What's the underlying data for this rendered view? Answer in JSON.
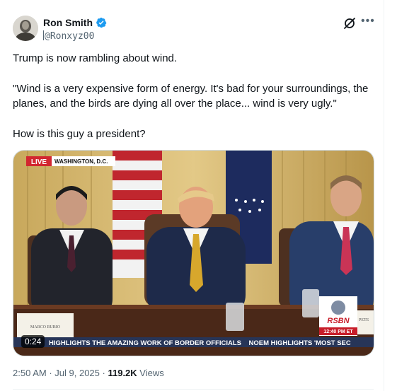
{
  "author": {
    "display_name": "Ron Smith",
    "handle": "@Ronxyz00",
    "verified": true
  },
  "tweet": {
    "paragraphs": [
      "Trump is now rambling about wind.",
      "\"Wind is a very expensive form of energy. It's bad for your surroundings, the planes, and the birds are dying all over the place... wind is very ugly.\"",
      "How is this guy a president?"
    ]
  },
  "media": {
    "type": "video",
    "duration": "0:24",
    "live_label": "LIVE",
    "location_label": "WASHINGTON, D.C.",
    "ticker_text": "HIGHLIGHTS THE AMAZING WORK OF BORDER OFFICIALS    NOEM HIGHLIGHTS 'MOST SEC",
    "network_logo": "RSBN",
    "clock": "12:40 PM ET",
    "nameplate_left": "MARCO RUBIO",
    "nameplate_right": "PETE"
  },
  "meta": {
    "time": "2:50 AM",
    "date": "Jul 9, 2025",
    "views_count": "119.2K",
    "views_label": "Views"
  },
  "icons": {
    "verified": "verified-badge-icon",
    "grok": "grok-icon",
    "more": "more-icon"
  },
  "colors": {
    "verified_blue": "#1d9bf0",
    "secondary_text": "#536471",
    "primary_text": "#0f1419"
  }
}
